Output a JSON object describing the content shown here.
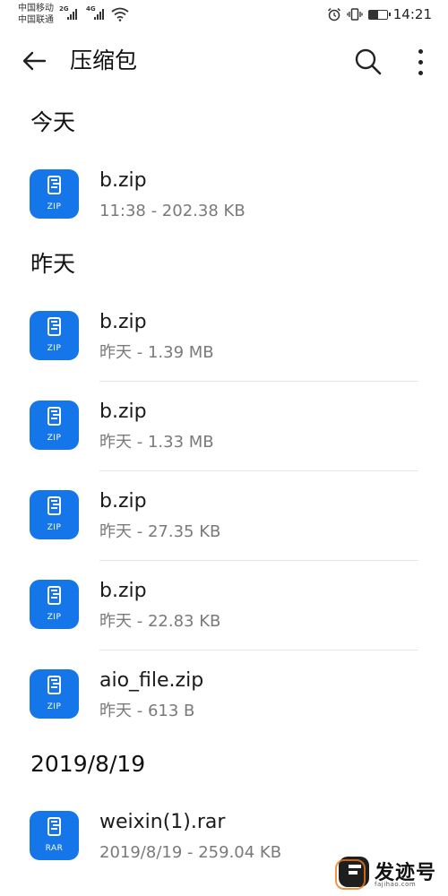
{
  "status_bar": {
    "carrier_1": "中国移动",
    "carrier_2": "中国联通",
    "network_1": "2G",
    "network_2": "4G",
    "time": "14:21",
    "battery_level": 0.5
  },
  "app_bar": {
    "title": "压缩包",
    "back_icon": "arrow-left-icon",
    "search_icon": "search-icon",
    "more_icon": "more-vertical-icon"
  },
  "colors": {
    "icon_blue": "#1576ea",
    "meta_gray": "#7a7a7a"
  },
  "sections": [
    {
      "header": "今天",
      "items": [
        {
          "name": "b.zip",
          "meta": "11:38 - 202.38 KB",
          "type": "ZIP"
        }
      ]
    },
    {
      "header": "昨天",
      "items": [
        {
          "name": "b.zip",
          "meta": "昨天 - 1.39 MB",
          "type": "ZIP"
        },
        {
          "name": "b.zip",
          "meta": "昨天 - 1.33 MB",
          "type": "ZIP"
        },
        {
          "name": "b.zip",
          "meta": "昨天 - 27.35 KB",
          "type": "ZIP"
        },
        {
          "name": "b.zip",
          "meta": "昨天 - 22.83 KB",
          "type": "ZIP"
        },
        {
          "name": "aio_file.zip",
          "meta": "昨天 - 613 B",
          "type": "ZIP"
        }
      ]
    },
    {
      "header": "2019/8/19",
      "items": [
        {
          "name": "weixin(1).rar",
          "meta": "2019/8/19 - 259.04 KB",
          "type": "RAR"
        }
      ]
    }
  ],
  "watermark": {
    "text": "发迹号",
    "subtext": "fajihao.com"
  }
}
